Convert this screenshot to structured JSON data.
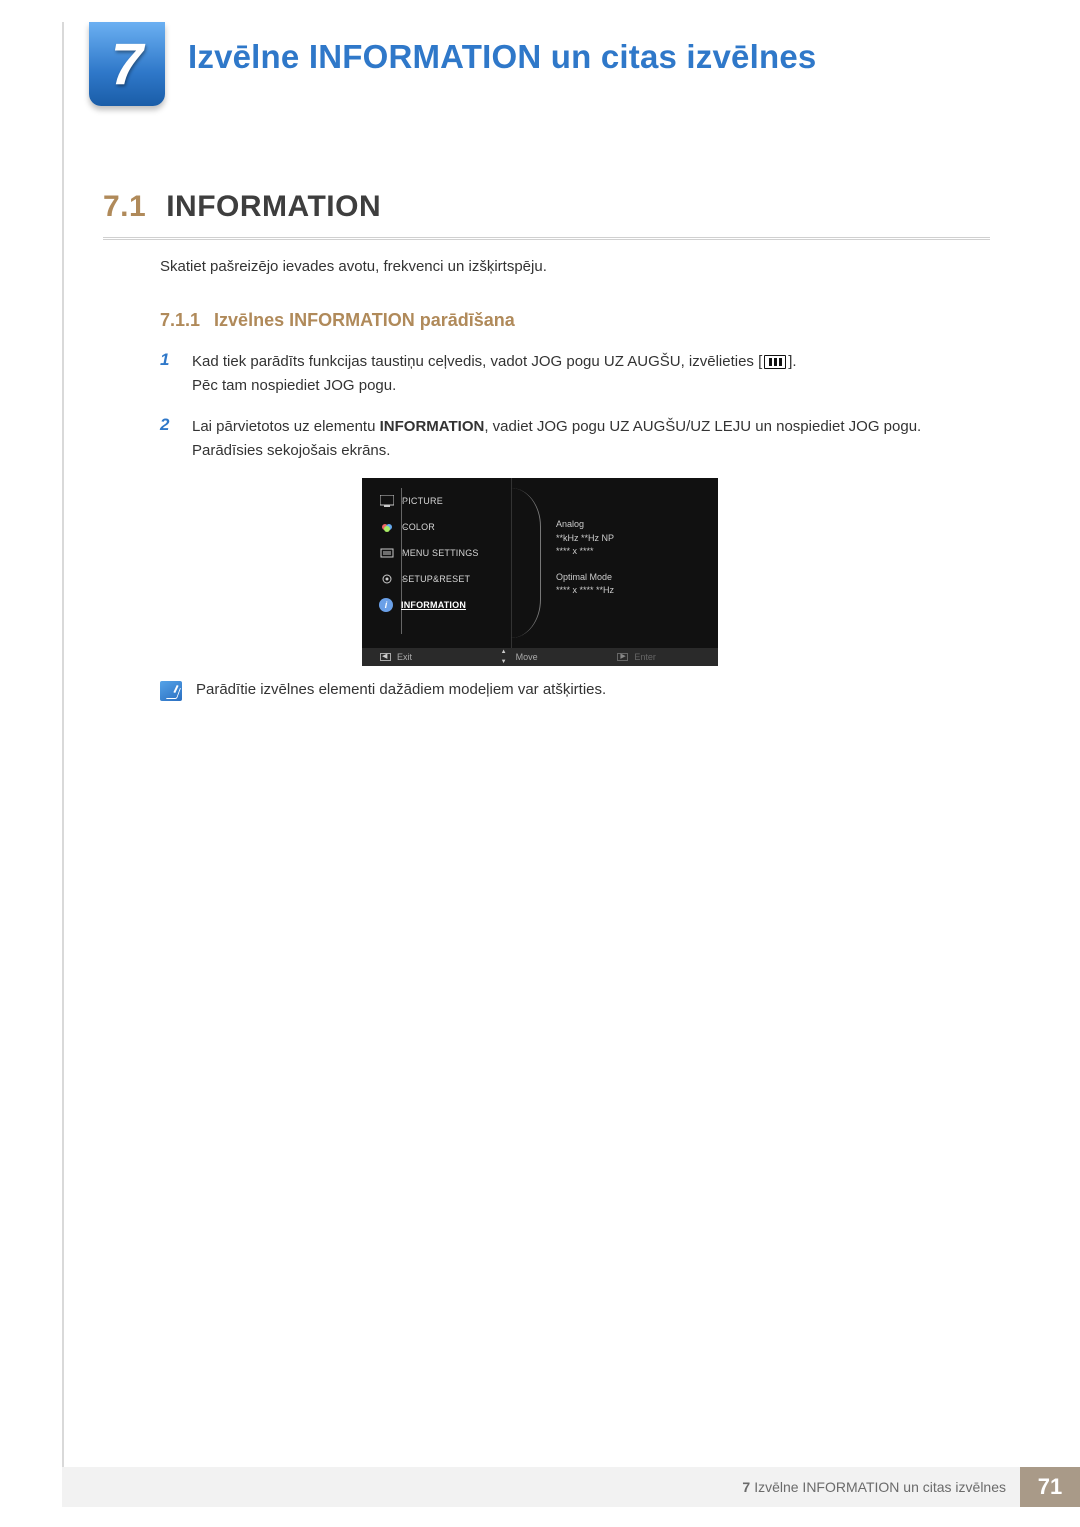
{
  "chapter": {
    "number": "7",
    "title": "Izvēlne INFORMATION un citas izvēlnes"
  },
  "section": {
    "number": "7.1",
    "title": "INFORMATION",
    "intro": "Skatiet pašreizējo ievades avotu, frekvenci un izšķirtspēju."
  },
  "subsection": {
    "number": "7.1.1",
    "title": "Izvēlnes INFORMATION parādīšana"
  },
  "steps": {
    "1": {
      "num": "1",
      "line_a": "Kad tiek parādīts funkcijas taustiņu ceļvedis, vadot JOG pogu UZ AUGŠU, izvēlieties [",
      "line_a2": "].",
      "line_b": "Pēc tam nospiediet JOG pogu."
    },
    "2": {
      "num": "2",
      "line_a": "Lai pārvietotos uz elementu ",
      "line_bold": "INFORMATION",
      "line_a2": ", vadiet JOG pogu UZ AUGŠU/UZ LEJU un nospiediet JOG pogu. Parādīsies sekojošais ekrāns."
    }
  },
  "osd": {
    "menu": {
      "picture": "PICTURE",
      "color": "COLOR",
      "menu_settings": "MENU SETTINGS",
      "setup_reset": "SETUP&RESET",
      "information": "INFORMATION"
    },
    "info": {
      "source": "Analog",
      "freq": "**kHz **Hz NP",
      "res": "**** x ****",
      "optimal_label": "Optimal Mode",
      "optimal_val": "**** x **** **Hz"
    },
    "footer": {
      "exit": "Exit",
      "move": "Move",
      "enter": "Enter"
    }
  },
  "note": "Parādītie izvēlnes elementi dažādiem modeļiem var atšķirties.",
  "footer": {
    "chapter_ref_num": "7",
    "chapter_ref_title": "Izvēlne INFORMATION un citas izvēlnes",
    "page": "71"
  }
}
